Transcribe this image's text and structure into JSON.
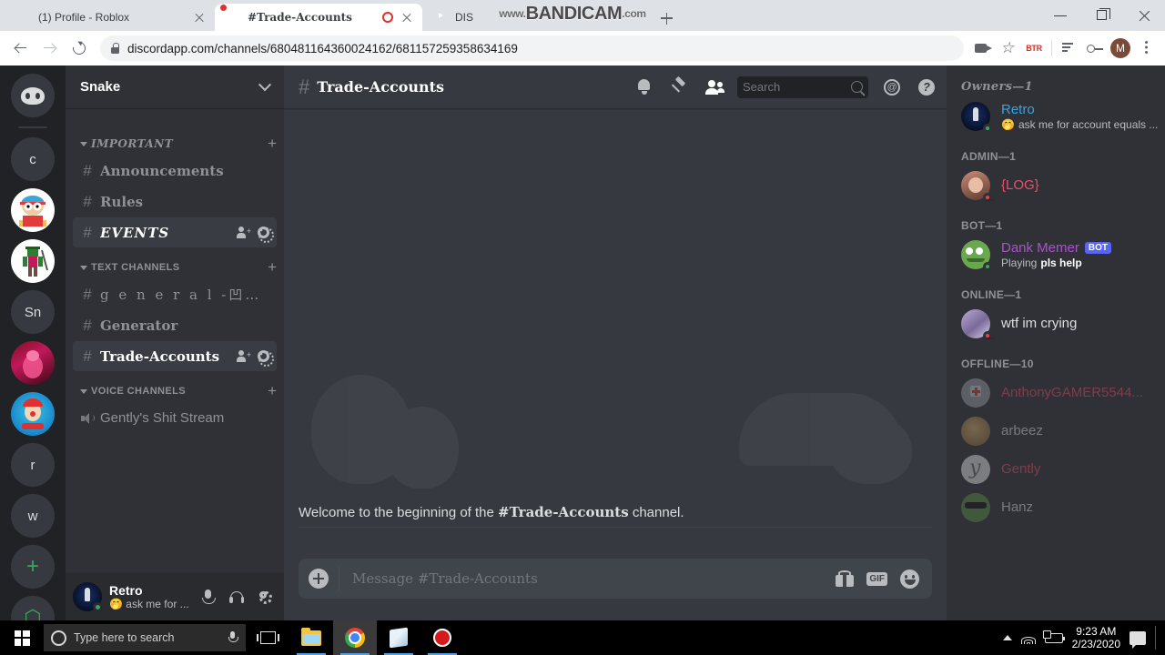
{
  "browser": {
    "tabs": [
      {
        "title": "(1) Profile - Roblox",
        "favicon": "roblox-icon",
        "active": false,
        "recording": false
      },
      {
        "title": "#Trade-Accounts",
        "favicon": "discord-icon",
        "active": true,
        "recording": true
      },
      {
        "title": "DIS",
        "favicon": "youtube-icon",
        "active": false,
        "recording": false
      }
    ],
    "new_tab_label": "+",
    "url": "discordapp.com/channels/680481164360024162/681157259358634169",
    "extension_label": "BTR",
    "profile_initial": "M",
    "watermark": {
      "prefix": "www.",
      "brand": "BANDICAM",
      "suffix": ".com"
    }
  },
  "discord": {
    "servers": [
      {
        "name": "discord-home",
        "label": ""
      },
      {
        "name": "server-c",
        "label": "c"
      },
      {
        "name": "server-cartman",
        "label": ""
      },
      {
        "name": "server-roblox",
        "label": ""
      },
      {
        "name": "server-sn",
        "label": "Sn"
      },
      {
        "name": "server-red",
        "label": ""
      },
      {
        "name": "server-clown",
        "label": ""
      },
      {
        "name": "server-r",
        "label": "r"
      },
      {
        "name": "server-w",
        "label": "w"
      },
      {
        "name": "add-server",
        "label": "+"
      },
      {
        "name": "explore-servers",
        "label": "⬡"
      }
    ],
    "guild": {
      "name": "Snake"
    },
    "categories": [
      {
        "name": "IMPORTANT",
        "channels": [
          {
            "name": "Announcements",
            "style": "goth",
            "active": false
          },
          {
            "name": "Rules",
            "style": "goth",
            "active": false
          },
          {
            "name": "EVENTS",
            "style": "goth-it",
            "active": true
          }
        ]
      },
      {
        "name": "TEXT CHANNELS",
        "channels": [
          {
            "name": "g e n e r a l -凹ラシ",
            "style": "spaced",
            "active": false
          },
          {
            "name": "Generator",
            "style": "goth",
            "active": false
          },
          {
            "name": "Trade-Accounts",
            "style": "goth",
            "active": true
          }
        ]
      },
      {
        "name": "VOICE CHANNELS",
        "channels": [
          {
            "name": "Gently's Shit Stream",
            "style": "plain",
            "active": false,
            "voice": true
          }
        ]
      }
    ],
    "user_panel": {
      "name": "Retro",
      "status": "ask me for ...",
      "status_emoji": "🤭"
    },
    "channel_header": {
      "hash": "#",
      "title": "Trade-Accounts"
    },
    "search": {
      "placeholder": "Search"
    },
    "welcome": {
      "prefix": "Welcome to the beginning of the ",
      "channel": "#Trade-Accounts",
      "suffix": " channel."
    },
    "message_input": {
      "placeholder": "Message #Trade-Accounts"
    },
    "member_groups": [
      {
        "label": "Owners—1",
        "style": "goth",
        "members": [
          {
            "name": "Retro",
            "color": "#3aa3e3",
            "status": "online",
            "sub": "ask me for account equals ...",
            "sub_emoji": "🤭",
            "avatar": "av-retro"
          }
        ]
      },
      {
        "label": "ADMIN—1",
        "style": "plain",
        "members": [
          {
            "name": "{LOG}",
            "color": "#ed4f6c",
            "status": "dnd",
            "sub": "",
            "avatar": "av-log"
          }
        ]
      },
      {
        "label": "BOT—1",
        "style": "plain",
        "members": [
          {
            "name": "Dank Memer",
            "color": "#a855c9",
            "status": "online",
            "sub_prefix": "Playing ",
            "sub_bold": "pls help",
            "badge": "BOT",
            "avatar": "av-pepe"
          }
        ]
      },
      {
        "label": "ONLINE—1",
        "style": "plain",
        "members": [
          {
            "name": "wtf im crying",
            "color": "#dcddde",
            "status": "dnd",
            "sub": "",
            "avatar": "av-wtf"
          }
        ]
      },
      {
        "label": "OFFLINE—10",
        "style": "plain",
        "offline": true,
        "members": [
          {
            "name": "AnthonyGAMER5544...",
            "color": "#ed4f6c",
            "avatar": "av-med"
          },
          {
            "name": "arbeez",
            "color": "#dcddde",
            "avatar": "av-doge"
          },
          {
            "name": "Gently",
            "color": "#ed4f6c",
            "avatar": "av-y"
          },
          {
            "name": "Hanz",
            "color": "#dcddde",
            "avatar": "av-pepe2"
          }
        ]
      }
    ]
  },
  "taskbar": {
    "search_placeholder": "Type here to search",
    "apps": [
      {
        "name": "task-view",
        "icon": "taskview-icon"
      },
      {
        "name": "file-explorer",
        "icon": "folder-icon"
      },
      {
        "name": "google-chrome",
        "icon": "chrome-icon"
      },
      {
        "name": "app-book",
        "icon": "book-icon"
      },
      {
        "name": "bandicam-recorder",
        "icon": "record-icon"
      }
    ],
    "time": "9:23 AM",
    "date": "2/23/2020"
  }
}
